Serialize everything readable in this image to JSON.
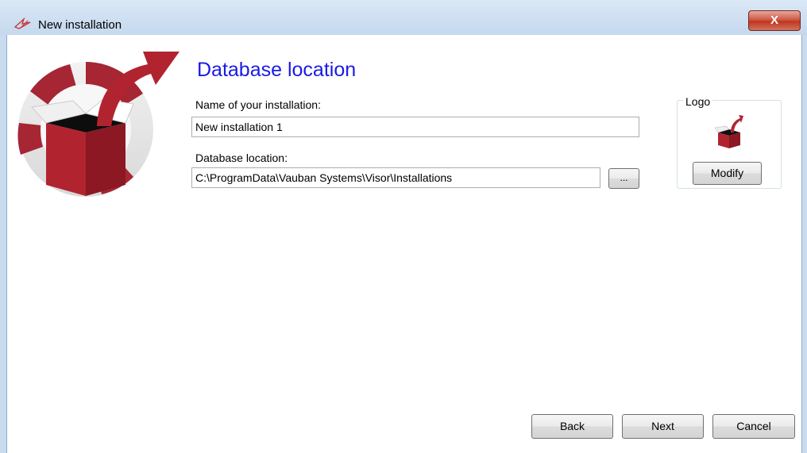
{
  "window": {
    "title": "New installation",
    "close_label": "X"
  },
  "heading": "Database location",
  "form": {
    "name_label": "Name of your installation:",
    "name_value": "New installation 1",
    "location_label": "Database location:",
    "location_value": "C:\\ProgramData\\Vauban Systems\\Visor\\Installations",
    "browse_label": "..."
  },
  "logo_group": {
    "title": "Logo",
    "modify_label": "Modify"
  },
  "buttons": {
    "back": "Back",
    "next": "Next",
    "cancel": "Cancel"
  },
  "colors": {
    "heading": "#1a1ae6",
    "box_red": "#b22330",
    "titlebar": "#c5d8ee"
  },
  "icons": {
    "window_icon": "vauban-logo-icon",
    "hero": "open-box-arrow-icon"
  }
}
